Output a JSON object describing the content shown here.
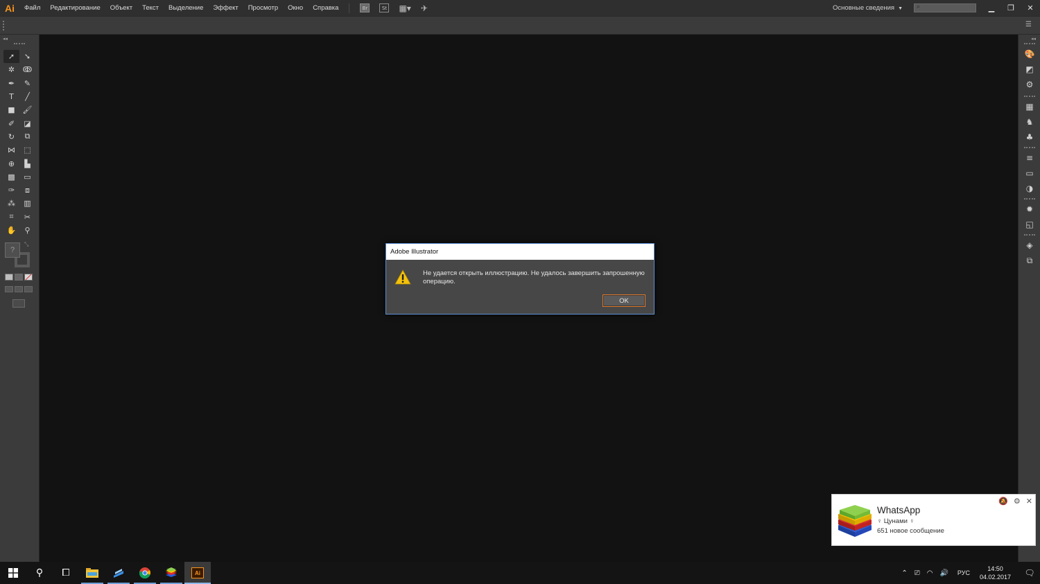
{
  "app": {
    "logo": "Ai"
  },
  "menu": {
    "items": [
      "Файл",
      "Редактирование",
      "Объект",
      "Текст",
      "Выделение",
      "Эффект",
      "Просмотр",
      "Окно",
      "Справка"
    ],
    "bridge_icon": "Br",
    "stock_icon": "St"
  },
  "workspace": {
    "label": "Основные сведения"
  },
  "dialog": {
    "title": "Adobe Illustrator",
    "message": "Не удается открыть иллюстрацию. Не удалось завершить запрошенную операцию.",
    "ok_label": "OK"
  },
  "fill_stroke": {
    "default_label": "?"
  },
  "toast": {
    "app": "WhatsApp",
    "sender": "Цунами",
    "sender_icon": "♀",
    "body": "651 новое сообщение"
  },
  "taskbar": {
    "ai_label": "Ai",
    "lang": "РУС",
    "time": "14:50",
    "date": "04.02.2017"
  },
  "colors": {
    "accent_orange": "#f7941d",
    "dialog_border": "#5b8fd6",
    "canvas": "#121212"
  }
}
